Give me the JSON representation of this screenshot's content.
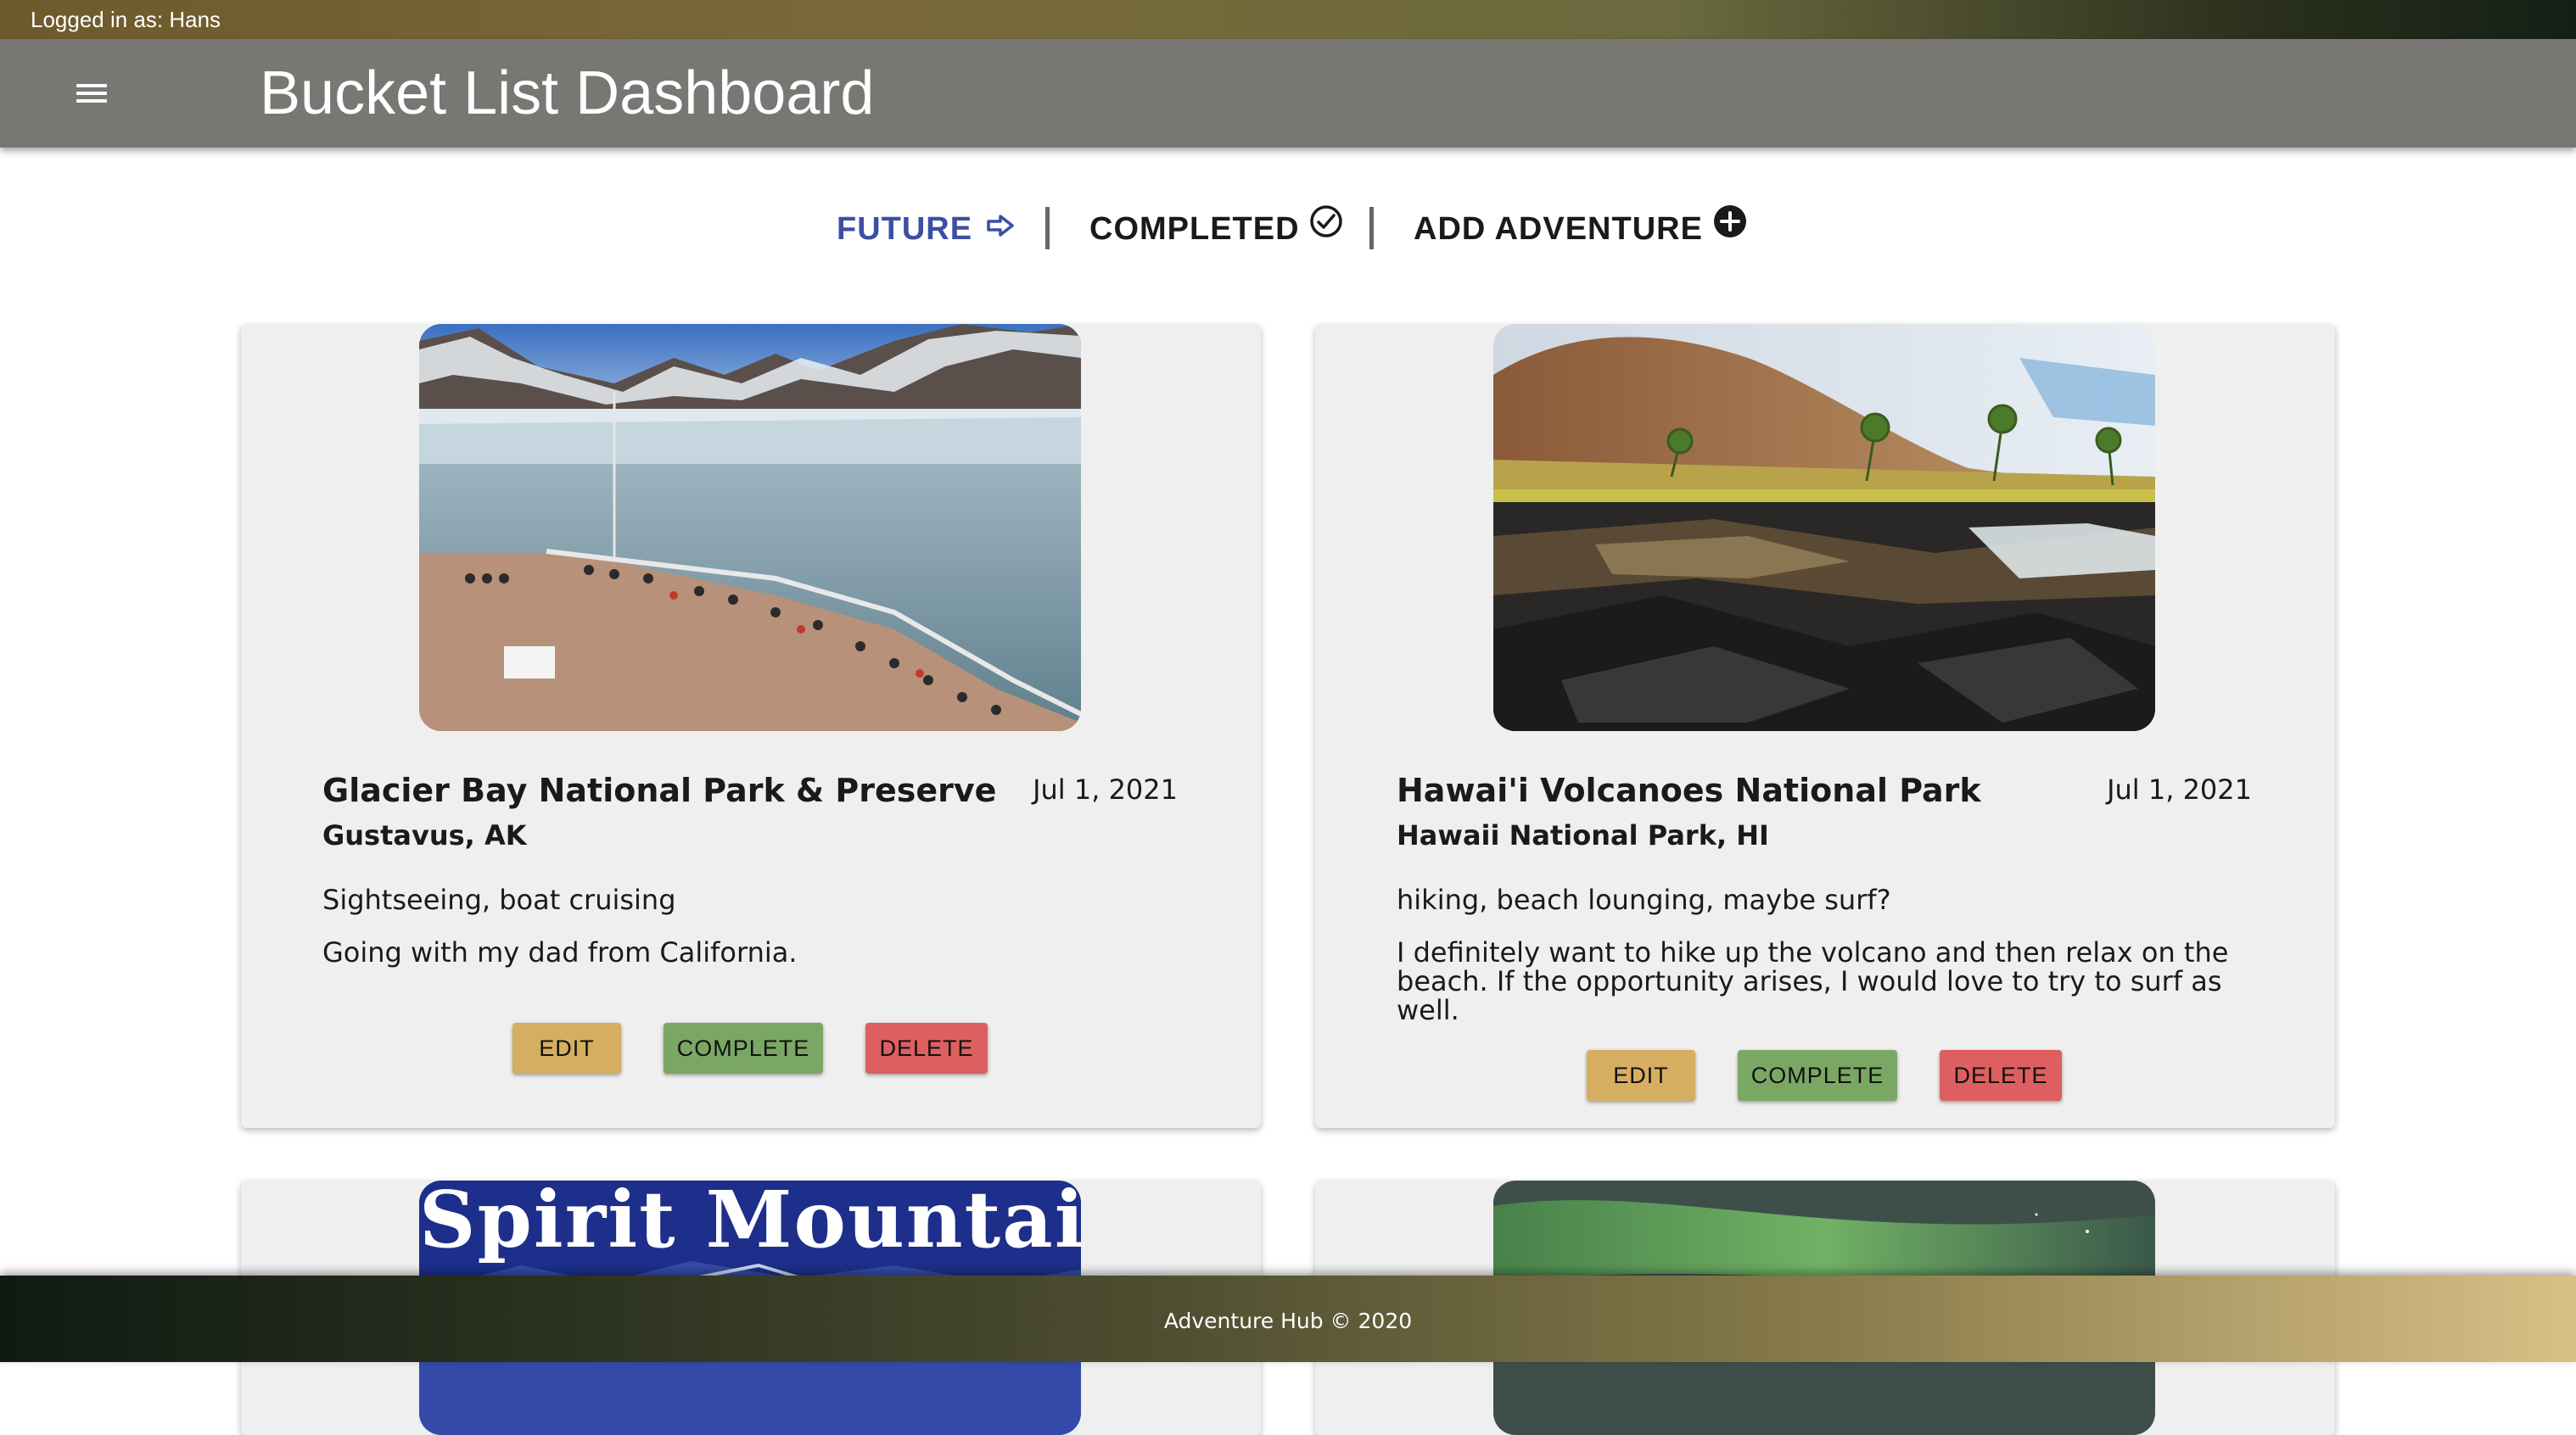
{
  "session": {
    "logged_in_text": "Logged in as: Hans"
  },
  "header": {
    "title": "Bucket List Dashboard",
    "menu_icon": "menu-icon"
  },
  "tabs": [
    {
      "label": "FUTURE",
      "icon": "arrow-right-outline-icon",
      "active": true
    },
    {
      "label": "COMPLETED",
      "icon": "check-circle-outline-icon",
      "active": false
    },
    {
      "label": "ADD ADVENTURE",
      "icon": "plus-circle-icon",
      "active": false
    }
  ],
  "adventures": [
    {
      "title": "Glacier Bay National Park & Preserve",
      "date": "Jul 1, 2021",
      "location": "Gustavus, AK",
      "activities": "Sightseeing, boat cruising",
      "notes": "Going with my dad from California.",
      "image": "glacier cruise ship photo",
      "buttons": {
        "edit": "EDIT",
        "complete": "COMPLETE",
        "delete": "DELETE"
      }
    },
    {
      "title": "Hawai'i Volcanoes National Park",
      "date": "Jul 1, 2021",
      "location": "Hawaii National Park, HI",
      "activities": "hiking, beach lounging, maybe surf?",
      "notes": "I definitely want to hike up the volcano and then relax on the beach. If the opportunity arises, I would love to try to surf as well.",
      "image": "lava rocks and palm trees photo",
      "buttons": {
        "edit": "EDIT",
        "complete": "COMPLETE",
        "delete": "DELETE"
      }
    },
    {
      "image_text": "Spirit Mountain",
      "image": "spirit mountain banner"
    },
    {
      "image": "northern lights photo"
    }
  ],
  "footer": {
    "text": "Adventure Hub © 2020"
  },
  "colors": {
    "active_tab": "#3c4fa3",
    "edit_button": "#d6ae62",
    "complete_button": "#7aa864",
    "delete_button": "#de5f5f",
    "app_bar": "#787774",
    "card_bg": "#efefef"
  }
}
